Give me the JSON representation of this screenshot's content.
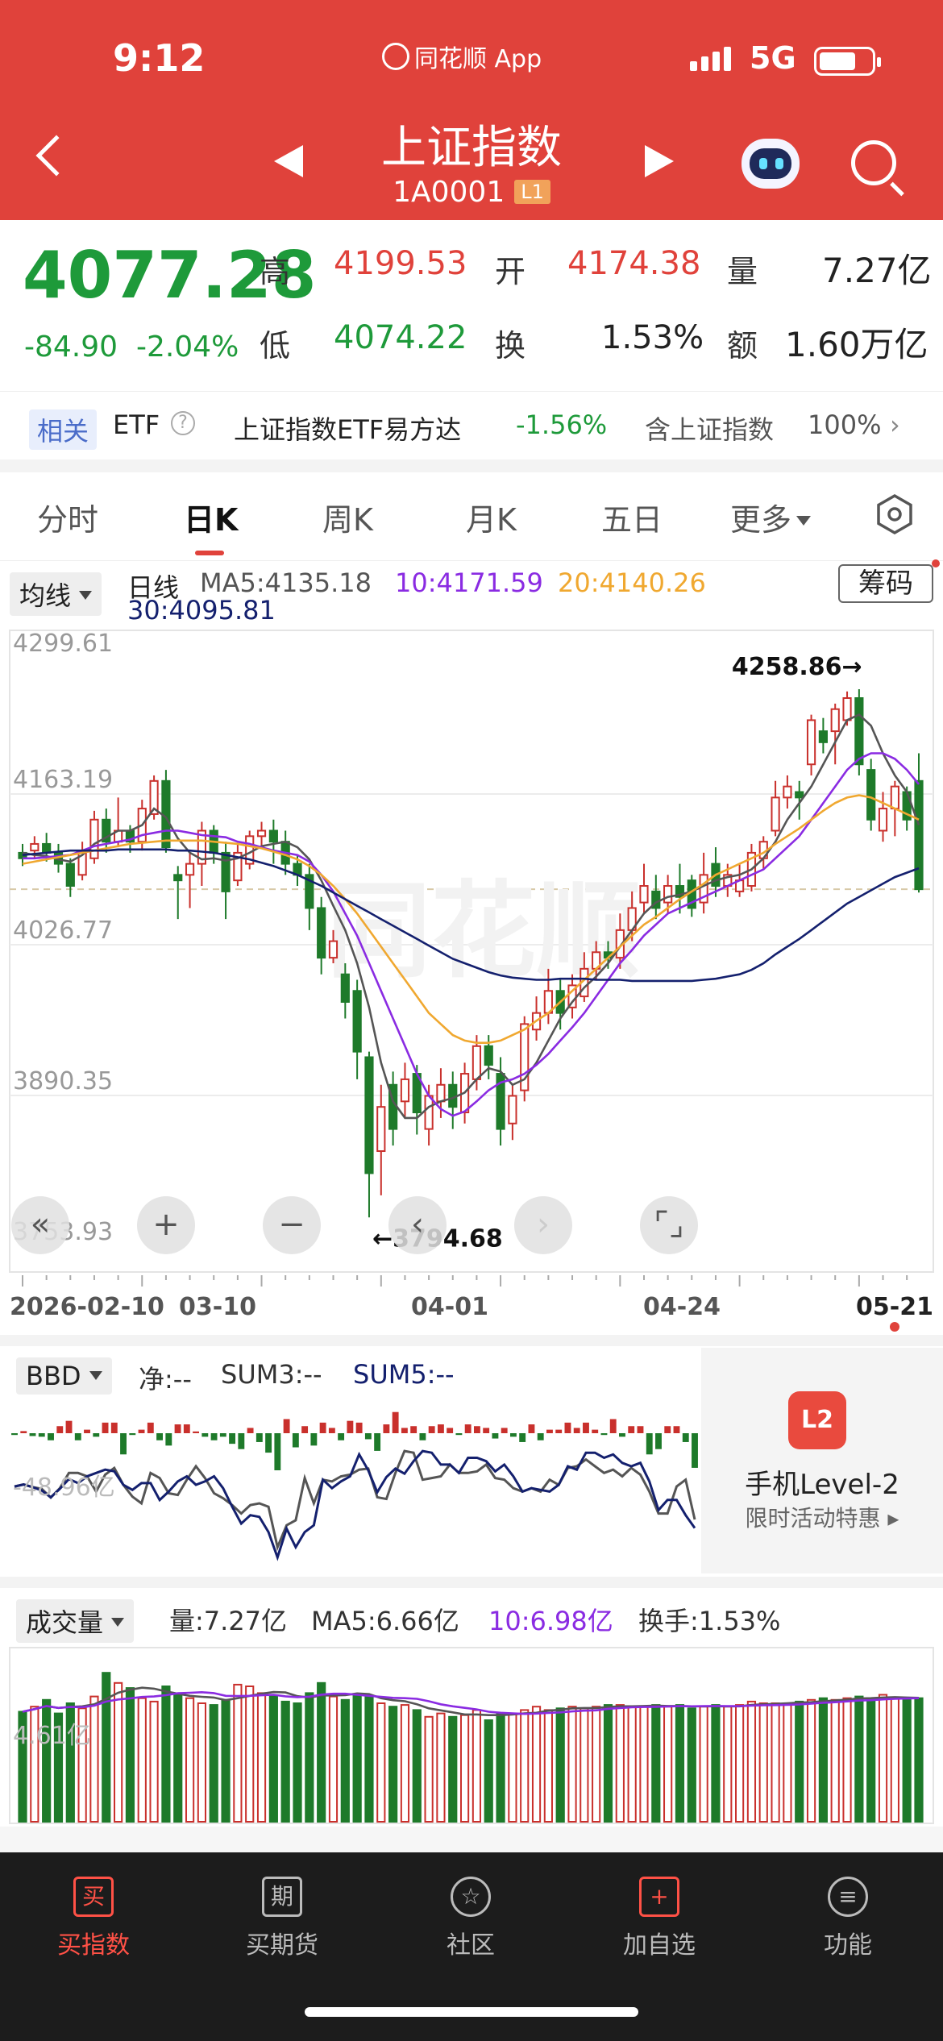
{
  "status": {
    "time": "9:12",
    "app_name": "同花顺 App",
    "network": "5G"
  },
  "header": {
    "title": "上证指数",
    "code": "1A0001",
    "level_badge": "L1"
  },
  "quote": {
    "price": "4077.28",
    "change": "-84.90",
    "change_pct": "-2.04%",
    "high_label": "高",
    "high": "4199.53",
    "open_label": "开",
    "open": "4174.38",
    "volume_label": "量",
    "volume": "7.27亿",
    "low_label": "低",
    "low": "4074.22",
    "turnover_label": "换",
    "turnover": "1.53%",
    "amount_label": "额",
    "amount": "1.60万亿"
  },
  "related": {
    "badge": "相关",
    "etf_label": "ETF",
    "help_icon": "?",
    "etf_name": "上证指数ETF易方达",
    "etf_change": "-1.56%",
    "contains_label": "含上证指数",
    "contains_pct": "100%",
    "more": "›"
  },
  "tabs": [
    {
      "label": "分时"
    },
    {
      "label": "日K"
    },
    {
      "label": "周K"
    },
    {
      "label": "月K"
    },
    {
      "label": "五日"
    },
    {
      "label": "更多"
    }
  ],
  "kline": {
    "indicator_select": "均线",
    "period_label": "日线",
    "ma5": "MA5:4135.18",
    "ma10": "10:4171.59",
    "ma20": "20:4140.26",
    "ma30": "30:4095.81",
    "chips_button": "筹码",
    "y_ticks": [
      "4299.61",
      "4163.19",
      "4026.77",
      "3890.35",
      "3753.93"
    ],
    "high_marker": "4258.86→",
    "low_marker": "←3794.68",
    "dates": [
      "2026-02-10",
      "03-10",
      "04-01",
      "04-24",
      "05-21"
    ],
    "controls": [
      "«",
      "+",
      "−",
      "‹",
      "›",
      "⌜⌟"
    ]
  },
  "bbd": {
    "select": "BBD",
    "net": "净:--",
    "sum3": "SUM3:--",
    "sum5": "SUM5:--",
    "axis_value": "-48.96亿"
  },
  "ad": {
    "icon_text": "L2",
    "title": "手机Level-2",
    "subtitle": "限时活动特惠 ▸"
  },
  "volume": {
    "select": "成交量",
    "vol": "量:7.27亿",
    "ma5": "MA5:6.66亿",
    "ma10": "10:6.98亿",
    "turnover": "换手:1.53%",
    "axis_value": "4.61亿"
  },
  "nav": [
    {
      "icon": "买",
      "label": "买指数"
    },
    {
      "icon": "期",
      "label": "买期货"
    },
    {
      "icon": "☆",
      "label": "社区"
    },
    {
      "icon": "+",
      "label": "加自选"
    },
    {
      "icon": "≡",
      "label": "功能"
    }
  ],
  "colors": {
    "brand": "#e0423b",
    "up": "#c9302c",
    "down": "#1e7a2a",
    "ma5": "#555555",
    "ma10": "#8a2be2",
    "ma20": "#f0a830",
    "ma30": "#14206e"
  },
  "chart_data": {
    "type": "candlestick",
    "y_range": [
      3753.93,
      4299.61
    ],
    "candles": [
      [
        4110,
        4105,
        4118,
        4098
      ],
      [
        4112,
        4118,
        4125,
        4105
      ],
      [
        4118,
        4110,
        4128,
        4102
      ],
      [
        4110,
        4100,
        4118,
        4092
      ],
      [
        4100,
        4080,
        4105,
        4070
      ],
      [
        4090,
        4110,
        4120,
        4085
      ],
      [
        4105,
        4140,
        4148,
        4100
      ],
      [
        4140,
        4120,
        4150,
        4110
      ],
      [
        4120,
        4130,
        4160,
        4115
      ],
      [
        4130,
        4120,
        4135,
        4110
      ],
      [
        4120,
        4150,
        4158,
        4112
      ],
      [
        4145,
        4175,
        4180,
        4140
      ],
      [
        4175,
        4115,
        4185,
        4110
      ],
      [
        4090,
        4085,
        4098,
        4050
      ],
      [
        4090,
        4100,
        4110,
        4060
      ],
      [
        4100,
        4130,
        4138,
        4080
      ],
      [
        4130,
        4110,
        4135,
        4100
      ],
      [
        4110,
        4075,
        4120,
        4050
      ],
      [
        4085,
        4110,
        4118,
        4080
      ],
      [
        4100,
        4125,
        4130,
        4095
      ],
      [
        4125,
        4130,
        4138,
        4115
      ],
      [
        4130,
        4120,
        4140,
        4100
      ],
      [
        4120,
        4100,
        4130,
        4090
      ],
      [
        4100,
        4090,
        4108,
        4080
      ],
      [
        4090,
        4060,
        4100,
        4040
      ],
      [
        4060,
        4015,
        4070,
        4000
      ],
      [
        4015,
        4030,
        4040,
        4010
      ],
      [
        4000,
        3975,
        4010,
        3960
      ],
      [
        3985,
        3930,
        3995,
        3905
      ],
      [
        3925,
        3820,
        3930,
        3780
      ],
      [
        3840,
        3880,
        3900,
        3800
      ],
      [
        3900,
        3860,
        3912,
        3845
      ],
      [
        3885,
        3905,
        3920,
        3870
      ],
      [
        3910,
        3875,
        3918,
        3855
      ],
      [
        3860,
        3890,
        3900,
        3845
      ],
      [
        3885,
        3900,
        3915,
        3870
      ],
      [
        3900,
        3880,
        3912,
        3860
      ],
      [
        3875,
        3910,
        3920,
        3865
      ],
      [
        3905,
        3935,
        3945,
        3895
      ],
      [
        3935,
        3918,
        3945,
        3905
      ],
      [
        3910,
        3860,
        3925,
        3845
      ],
      [
        3865,
        3890,
        3900,
        3850
      ],
      [
        3895,
        3955,
        3962,
        3885
      ],
      [
        3950,
        3965,
        3980,
        3940
      ],
      [
        3965,
        3985,
        4005,
        3955
      ],
      [
        3985,
        3965,
        3995,
        3950
      ],
      [
        3970,
        3990,
        4000,
        3960
      ],
      [
        3980,
        4005,
        4020,
        3975
      ],
      [
        4005,
        4020,
        4030,
        3995
      ],
      [
        4020,
        4015,
        4030,
        4005
      ],
      [
        4015,
        4040,
        4055,
        4005
      ],
      [
        4040,
        4060,
        4075,
        4030
      ],
      [
        4065,
        4080,
        4100,
        4055
      ],
      [
        4075,
        4060,
        4090,
        4050
      ],
      [
        4065,
        4080,
        4090,
        4055
      ],
      [
        4080,
        4070,
        4100,
        4055
      ],
      [
        4085,
        4060,
        4090,
        4052
      ],
      [
        4065,
        4090,
        4110,
        4055
      ],
      [
        4100,
        4080,
        4115,
        4070
      ],
      [
        4080,
        4090,
        4100,
        4070
      ],
      [
        4075,
        4085,
        4100,
        4070
      ],
      [
        4080,
        4110,
        4118,
        4075
      ],
      [
        4105,
        4120,
        4125,
        4095
      ],
      [
        4130,
        4160,
        4175,
        4125
      ],
      [
        4160,
        4170,
        4180,
        4150
      ],
      [
        4165,
        4160,
        4175,
        4140
      ],
      [
        4190,
        4230,
        4235,
        4180
      ],
      [
        4220,
        4210,
        4232,
        4200
      ],
      [
        4220,
        4240,
        4245,
        4190
      ],
      [
        4230,
        4250,
        4256,
        4225
      ],
      [
        4250,
        4190,
        4258,
        4180
      ],
      [
        4185,
        4140,
        4195,
        4130
      ],
      [
        4130,
        4150,
        4165,
        4120
      ],
      [
        4150,
        4170,
        4175,
        4125
      ],
      [
        4165,
        4140,
        4170,
        4130
      ],
      [
        4175,
        4077,
        4200,
        4074
      ]
    ],
    "ma_series": {
      "MA5": [
        4110,
        4108,
        4107,
        4104,
        4102,
        4108,
        4118,
        4124,
        4130,
        4130,
        4135,
        4150,
        4142,
        4123,
        4110,
        4104,
        4105,
        4103,
        4105,
        4110,
        4116,
        4118,
        4120,
        4115,
        4104,
        4085,
        4062,
        4040,
        4010,
        3970,
        3920,
        3885,
        3870,
        3870,
        3880,
        3885,
        3888,
        3893,
        3905,
        3915,
        3912,
        3900,
        3905,
        3920,
        3940,
        3960,
        3975,
        3988,
        3998,
        4010,
        4025,
        4040,
        4055,
        4065,
        4070,
        4072,
        4075,
        4080,
        4085,
        4088,
        4090,
        4095,
        4105,
        4120,
        4140,
        4155,
        4170,
        4190,
        4210,
        4230,
        4235,
        4225,
        4200,
        4180,
        4165,
        4135
      ],
      "MA10": [
        4105,
        4105,
        4106,
        4107,
        4108,
        4112,
        4116,
        4118,
        4120,
        4122,
        4126,
        4128,
        4130,
        4130,
        4128,
        4126,
        4125,
        4124,
        4120,
        4118,
        4115,
        4112,
        4110,
        4108,
        4102,
        4090,
        4075,
        4055,
        4035,
        4010,
        3985,
        3960,
        3935,
        3910,
        3890,
        3878,
        3872,
        3876,
        3885,
        3895,
        3902,
        3905,
        3910,
        3918,
        3928,
        3940,
        3952,
        3965,
        3980,
        3995,
        4010,
        4022,
        4035,
        4045,
        4055,
        4060,
        4065,
        4070,
        4075,
        4080,
        4085,
        4090,
        4095,
        4105,
        4115,
        4125,
        4140,
        4155,
        4170,
        4185,
        4195,
        4200,
        4200,
        4195,
        4185,
        4172
      ],
      "MA20": [
        4100,
        4102,
        4104,
        4106,
        4108,
        4110,
        4112,
        4114,
        4116,
        4118,
        4119,
        4120,
        4121,
        4121,
        4121,
        4121,
        4120,
        4119,
        4118,
        4116,
        4114,
        4111,
        4108,
        4104,
        4098,
        4090,
        4080,
        4068,
        4055,
        4040,
        4025,
        4010,
        3995,
        3980,
        3965,
        3955,
        3945,
        3940,
        3938,
        3938,
        3940,
        3945,
        3950,
        3958,
        3965,
        3975,
        3985,
        3995,
        4005,
        4015,
        4025,
        4035,
        4045,
        4052,
        4060,
        4068,
        4075,
        4082,
        4090,
        4095,
        4100,
        4105,
        4110,
        4118,
        4125,
        4132,
        4140,
        4148,
        4155,
        4160,
        4162,
        4160,
        4155,
        4150,
        4145,
        4140
      ],
      "MA30": [
        4108,
        4109,
        4110,
        4111,
        4112,
        4112,
        4112,
        4112,
        4113,
        4113,
        4113,
        4113,
        4113,
        4112,
        4112,
        4111,
        4110,
        4108,
        4106,
        4104,
        4101,
        4098,
        4094,
        4090,
        4085,
        4080,
        4074,
        4068,
        4062,
        4056,
        4050,
        4044,
        4038,
        4032,
        4026,
        4020,
        4014,
        4010,
        4006,
        4002,
        3999,
        3997,
        3996,
        3995,
        3995,
        3996,
        3996,
        3996,
        3995,
        3995,
        3995,
        3994,
        3994,
        3994,
        3994,
        3994,
        3994,
        3995,
        3996,
        3998,
        4000,
        4004,
        4010,
        4018,
        4025,
        4032,
        4040,
        4048,
        4056,
        4064,
        4070,
        4076,
        4082,
        4088,
        4092,
        4096
      ]
    },
    "volume": [
      6.5,
      6.8,
      7.2,
      6.4,
      7.0,
      6.7,
      7.4,
      8.8,
      8.2,
      7.9,
      7.3,
      7.1,
      8.0,
      7.5,
      7.3,
      7.0,
      6.9,
      7.2,
      8.1,
      8.0,
      7.6,
      7.4,
      7.1,
      7.0,
      7.6,
      8.2,
      7.4,
      7.2,
      7.5,
      7.4,
      7.0,
      6.8,
      6.9,
      6.6,
      6.2,
      6.4,
      6.2,
      6.3,
      6.6,
      6.0,
      6.4,
      6.4,
      6.6,
      6.8,
      6.6,
      6.7,
      6.8,
      6.7,
      6.8,
      6.9,
      6.9,
      6.8,
      6.8,
      6.9,
      6.8,
      6.9,
      6.7,
      6.8,
      6.9,
      6.8,
      6.9,
      7.1,
      7.0,
      7.0,
      7.0,
      7.1,
      7.2,
      7.3,
      7.2,
      7.3,
      7.4,
      7.3,
      7.5,
      7.3,
      7.2,
      7.3
    ],
    "volume_range": [
      0,
      10
    ]
  }
}
